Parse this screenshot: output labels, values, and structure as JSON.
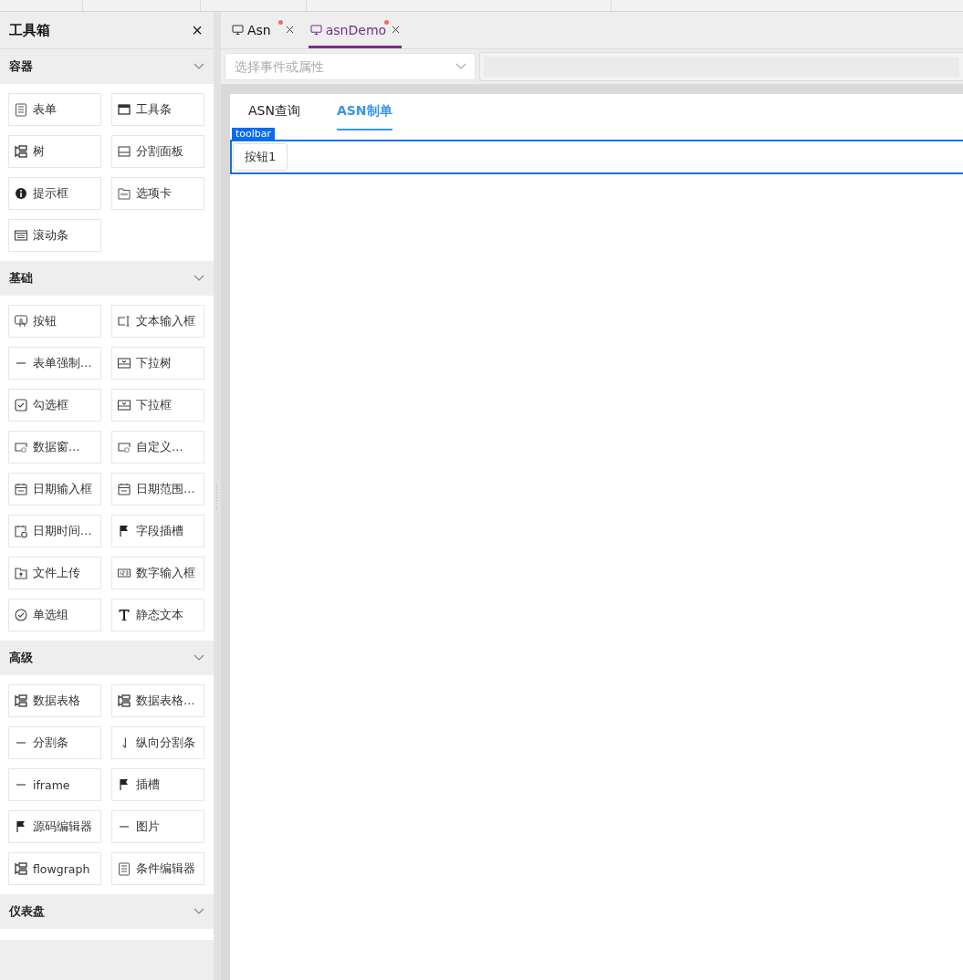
{
  "toolbox": {
    "title": "工具箱",
    "close_icon": "×",
    "sections": [
      {
        "title": "容器",
        "expanded": true,
        "items": [
          {
            "label": "表单",
            "kind": "form"
          },
          {
            "label": "工具条",
            "kind": "window"
          },
          {
            "label": "树",
            "kind": "tree"
          },
          {
            "label": "分割面板",
            "kind": "split"
          },
          {
            "label": "提示框",
            "kind": "info"
          },
          {
            "label": "选项卡",
            "kind": "tab"
          },
          {
            "label": "滚动条",
            "kind": "list"
          }
        ]
      },
      {
        "title": "基础",
        "expanded": true,
        "items": [
          {
            "label": "按钮",
            "kind": "hand"
          },
          {
            "label": "文本输入框",
            "kind": "input"
          },
          {
            "label": "表单强制…",
            "kind": "dash"
          },
          {
            "label": "下拉树",
            "kind": "dropdown"
          },
          {
            "label": "勾选框",
            "kind": "checkbox"
          },
          {
            "label": "下拉框",
            "kind": "dropdown"
          },
          {
            "label": "数据窗…",
            "kind": "lookup"
          },
          {
            "label": "自定义…",
            "kind": "lookup"
          },
          {
            "label": "日期输入框",
            "kind": "calendar"
          },
          {
            "label": "日期范围…",
            "kind": "calendar"
          },
          {
            "label": "日期时间…",
            "kind": "datetime"
          },
          {
            "label": "字段插槽",
            "kind": "flag"
          },
          {
            "label": "文件上传",
            "kind": "upload"
          },
          {
            "label": "数字输入框",
            "kind": "number"
          },
          {
            "label": "单选组",
            "kind": "radio"
          },
          {
            "label": "静态文本",
            "kind": "text"
          }
        ]
      },
      {
        "title": "高级",
        "expanded": true,
        "items": [
          {
            "label": "数据表格",
            "kind": "tree"
          },
          {
            "label": "数据表格…",
            "kind": "tree"
          },
          {
            "label": "分割条",
            "kind": "dash"
          },
          {
            "label": "纵向分割条",
            "kind": "down"
          },
          {
            "label": "iframe",
            "kind": "dash"
          },
          {
            "label": "插槽",
            "kind": "flag"
          },
          {
            "label": "源码编辑器",
            "kind": "flag"
          },
          {
            "label": "图片",
            "kind": "dash"
          },
          {
            "label": "flowgraph",
            "kind": "tree"
          },
          {
            "label": "条件编辑器",
            "kind": "form"
          }
        ]
      },
      {
        "title": "仪表盘",
        "expanded": true
      }
    ]
  },
  "doc_tabs": [
    {
      "label": "Asn",
      "selected": false,
      "modified": true
    },
    {
      "label": "asnDemo",
      "selected": true,
      "modified": true
    }
  ],
  "event_select": {
    "placeholder": "选择事件或属性"
  },
  "page_tabs": [
    {
      "label": "ASN查询",
      "selected": false
    },
    {
      "label": "ASN制单",
      "selected": true
    }
  ],
  "toolbar": {
    "badge": "toolbar",
    "buttons": [
      "按钮1"
    ]
  }
}
